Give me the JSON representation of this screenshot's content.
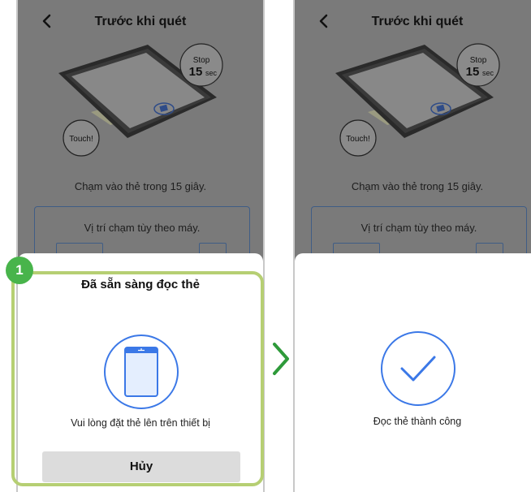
{
  "screen": {
    "title": "Trước khi quét",
    "touch_label": "Touch!",
    "stop_label": "Stop",
    "stop_number": "15",
    "stop_unit": "sec",
    "caption": "Chạm vào thẻ trong 15 giây.",
    "info_text": "Vị trí chạm tùy theo máy."
  },
  "left_sheet": {
    "title": "Đã sẵn sàng đọc thẻ",
    "message": "Vui lòng đặt thẻ lên trên thiết bị",
    "cancel_label": "Hủy"
  },
  "right_sheet": {
    "message": "Đọc thẻ thành công"
  },
  "step_number": "1",
  "colors": {
    "overlay_background": "#7a7a7a",
    "accent_blue": "#3b78e7",
    "highlight_green": "#b6cf73",
    "step_badge_green": "#48b44b",
    "arrow_green": "#2e9a3a"
  },
  "icons": [
    "back-chevron-icon",
    "phone-nfc-icon",
    "checkmark-icon",
    "next-arrow-icon"
  ]
}
